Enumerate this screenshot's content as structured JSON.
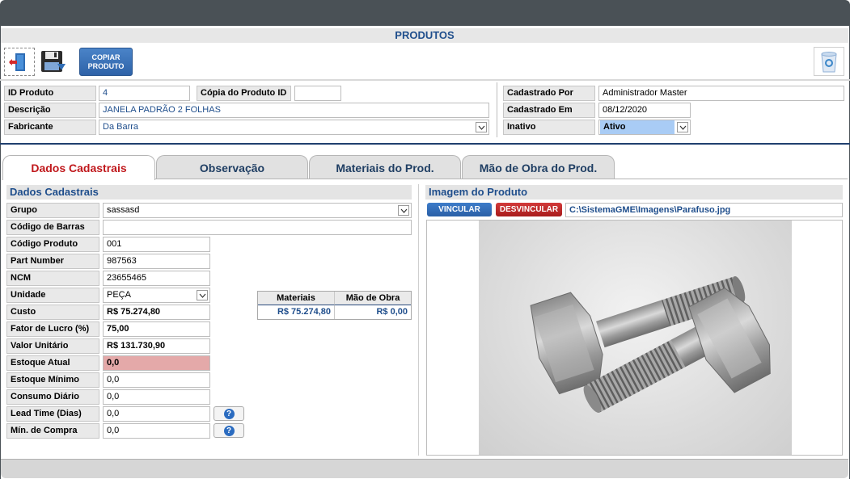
{
  "window": {
    "title": "PRODUTOS"
  },
  "toolbar": {
    "exit_icon": "exit-door-icon",
    "save_icon": "floppy-disk-icon",
    "copy_label_1": "COPIAR",
    "copy_label_2": "PRODUTO",
    "trash_icon": "recycle-bin-icon"
  },
  "header": {
    "id_produto_label": "ID Produto",
    "id_produto_value": "4",
    "copia_label": "Cópia do Produto ID",
    "copia_value": "",
    "descricao_label": "Descrição",
    "descricao_value": "JANELA PADRÃO 2 FOLHAS",
    "fabricante_label": "Fabricante",
    "fabricante_value": "Da Barra",
    "cadastrado_por_label": "Cadastrado Por",
    "cadastrado_por_value": "Administrador Master",
    "cadastrado_em_label": "Cadastrado Em",
    "cadastrado_em_value": "08/12/2020",
    "inativo_label": "Inativo",
    "inativo_value": "Ativo"
  },
  "tabs": [
    {
      "label": "Dados Cadastrais",
      "active": true
    },
    {
      "label": "Observação",
      "active": false
    },
    {
      "label": "Materiais do Prod.",
      "active": false
    },
    {
      "label": "Mão de Obra do Prod.",
      "active": false
    }
  ],
  "dados": {
    "section_title": "Dados Cadastrais",
    "fields": [
      {
        "label": "Grupo",
        "value": "sassasd"
      },
      {
        "label": "Código de Barras",
        "value": ""
      },
      {
        "label": "Código Produto",
        "value": "001"
      },
      {
        "label": "Part Number",
        "value": "987563"
      },
      {
        "label": "NCM",
        "value": "23655465"
      },
      {
        "label": "Unidade",
        "value": "PEÇA"
      },
      {
        "label": "Custo",
        "value": "R$ 75.274,80"
      },
      {
        "label": "Fator de Lucro (%)",
        "value": "75,00"
      },
      {
        "label": "Valor Unitário",
        "value": "R$ 131.730,90"
      },
      {
        "label": "Estoque Atual",
        "value": "0,0"
      },
      {
        "label": "Estoque Mínimo",
        "value": "0,0"
      },
      {
        "label": "Consumo Diário",
        "value": "0,0"
      },
      {
        "label": "Lead Time (Dias)",
        "value": "0,0"
      },
      {
        "label": "Mín. de Compra",
        "value": "0,0"
      }
    ],
    "custos_table": {
      "headers": [
        "Materiais",
        "Mão de Obra"
      ],
      "values": [
        "R$ 75.274,80",
        "R$ 0,00"
      ]
    },
    "help_icon": "question-mark-icon"
  },
  "imagem": {
    "section_title": "Imagem do Produto",
    "vincular_label": "VINCULAR",
    "desvincular_label": "DESVINCULAR",
    "path": "C:\\SistemaGME\\Imagens\\Parafuso.jpg"
  },
  "colors": {
    "accent_blue": "#1f4e8c",
    "active_tab_red": "#c0181c",
    "stock_alert": "#e4a9a9",
    "inactive_select": "#a9ccf5"
  }
}
